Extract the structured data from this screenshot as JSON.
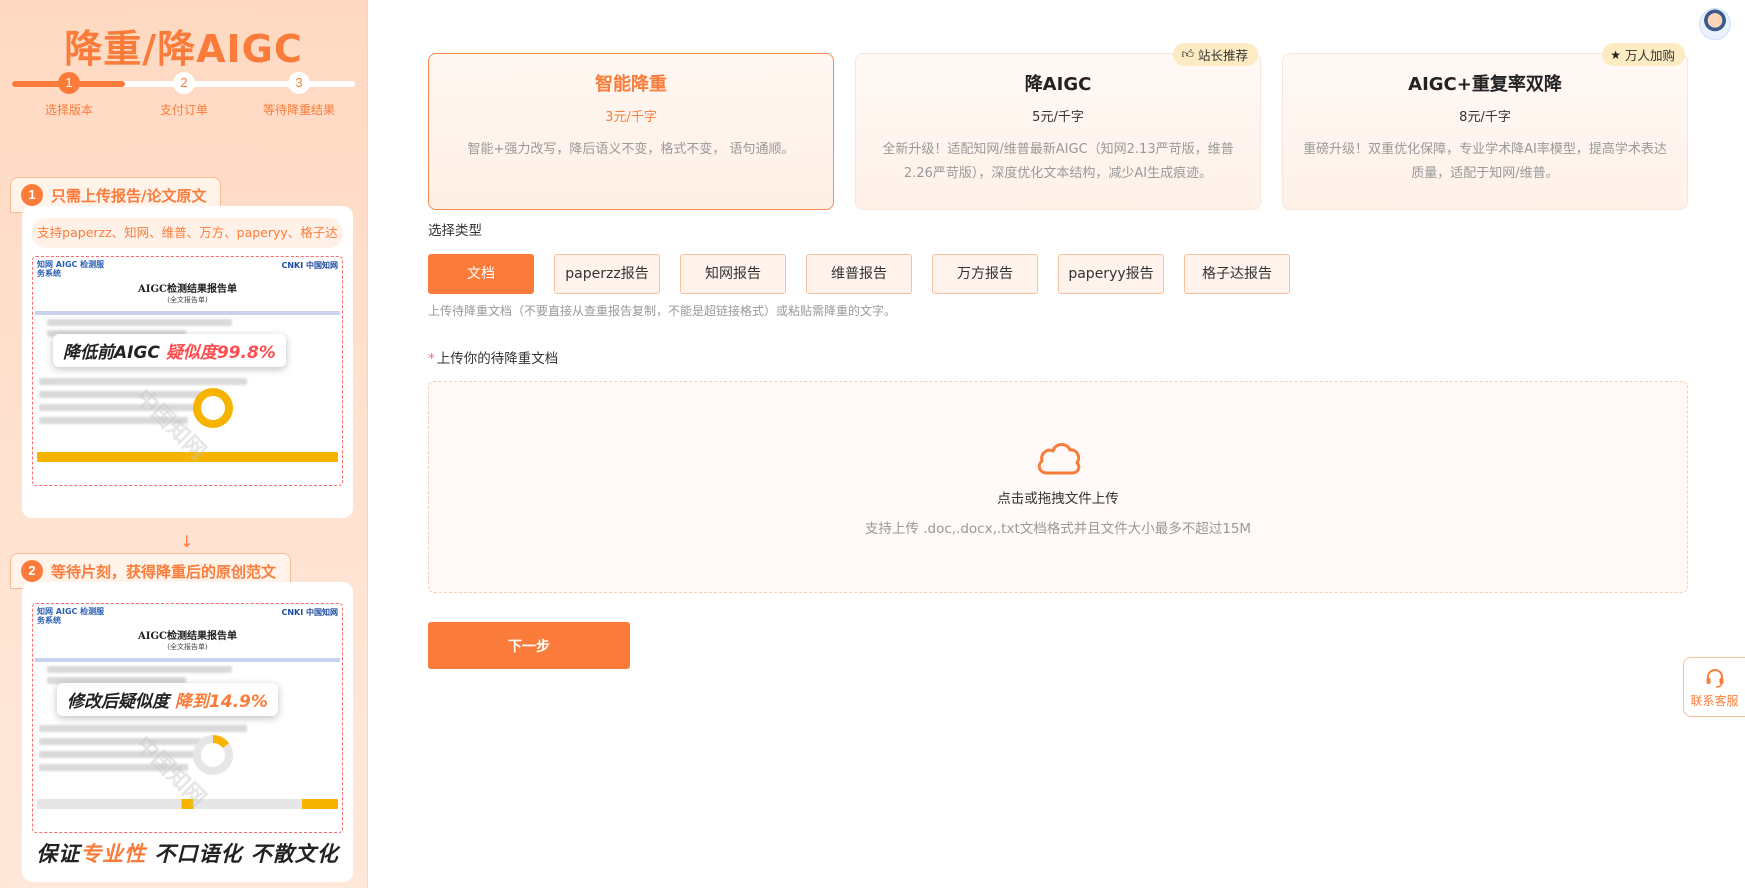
{
  "left": {
    "brand_title": "降重/降AIGC",
    "steps": [
      {
        "num": "1",
        "label": "选择版本"
      },
      {
        "num": "2",
        "label": "支付订单"
      },
      {
        "num": "3",
        "label": "等待降重结果"
      }
    ],
    "progress_fraction": 0.33,
    "section1": {
      "num": "1",
      "title": "只需上传报告/论文原文"
    },
    "support_text": "支持paperzz、知网、维普、万方、paperyy、格子达",
    "report_before": {
      "logo_left": "知网 AIGC 检测服务系统",
      "logo_right": "CNKI 中国知网",
      "title": "AIGC检测结果报告单",
      "subtitle": "(全文报告单)",
      "callout_prefix": "降低前AIGC",
      "callout_highlight": "疑似度99.8%"
    },
    "arrow": "↓",
    "section2": {
      "num": "2",
      "title": "等待片刻，获得降重后的原创范文"
    },
    "report_after": {
      "logo_left": "知网 AIGC 检测服务系统",
      "logo_right": "CNKI 中国知网",
      "title": "AIGC检测结果报告单",
      "subtitle": "(全文报告单)",
      "callout_prefix": "修改后疑似度",
      "callout_highlight": "降到14.9%"
    },
    "watermark": "中国知网",
    "slogan": {
      "part1": "保证",
      "highlight": "专业性",
      "part2": " 不口语化 不散文化"
    }
  },
  "plans": [
    {
      "name": "智能降重",
      "price": "3元/千字",
      "desc": "智能+强力改写，降后语义不变，格式不变， 语句通顺。",
      "active": true,
      "badge": ""
    },
    {
      "name": "降AIGC",
      "price": "5元/千字",
      "desc": "全新升级！适配知网/维普最新AIGC（知网2.13严苛版，维普2.26严苛版），深度优化文本结构，减少AI生成痕迹。",
      "active": false,
      "badge": "站长推荐",
      "badge_icon": "thumbs-up-icon"
    },
    {
      "name": "AIGC+重复率双降",
      "price": "8元/千字",
      "desc": "重磅升级！双重优化保障，专业学术降AI率模型，提高学术表达质量，适配于知网/维普。",
      "active": false,
      "badge": "万人加购",
      "badge_icon": "star-icon"
    }
  ],
  "type_section": {
    "label": "选择类型",
    "types": [
      "文档",
      "paperzz报告",
      "知网报告",
      "维普报告",
      "万方报告",
      "paperyy报告",
      "格子达报告"
    ],
    "selected": "文档",
    "hint": "上传待降重文档（不要直接从查重报告复制，不能是超链接格式）或粘贴需降重的文字。"
  },
  "upload": {
    "required_mark": "*",
    "label": "上传你的待降重文档",
    "title": "点击或拖拽文件上传",
    "subtitle": "支持上传 .doc,.docx,.txt文档格式并且文件大小最多不超过15M",
    "icon": "cloud-upload-icon"
  },
  "next_button": "下一步",
  "service": {
    "label": "联系客服",
    "icon": "headset-icon"
  },
  "colors": {
    "accent": "#fb7c3a",
    "badge_bg": "#fdebc3",
    "panel_bg": "#ffd9c2"
  }
}
